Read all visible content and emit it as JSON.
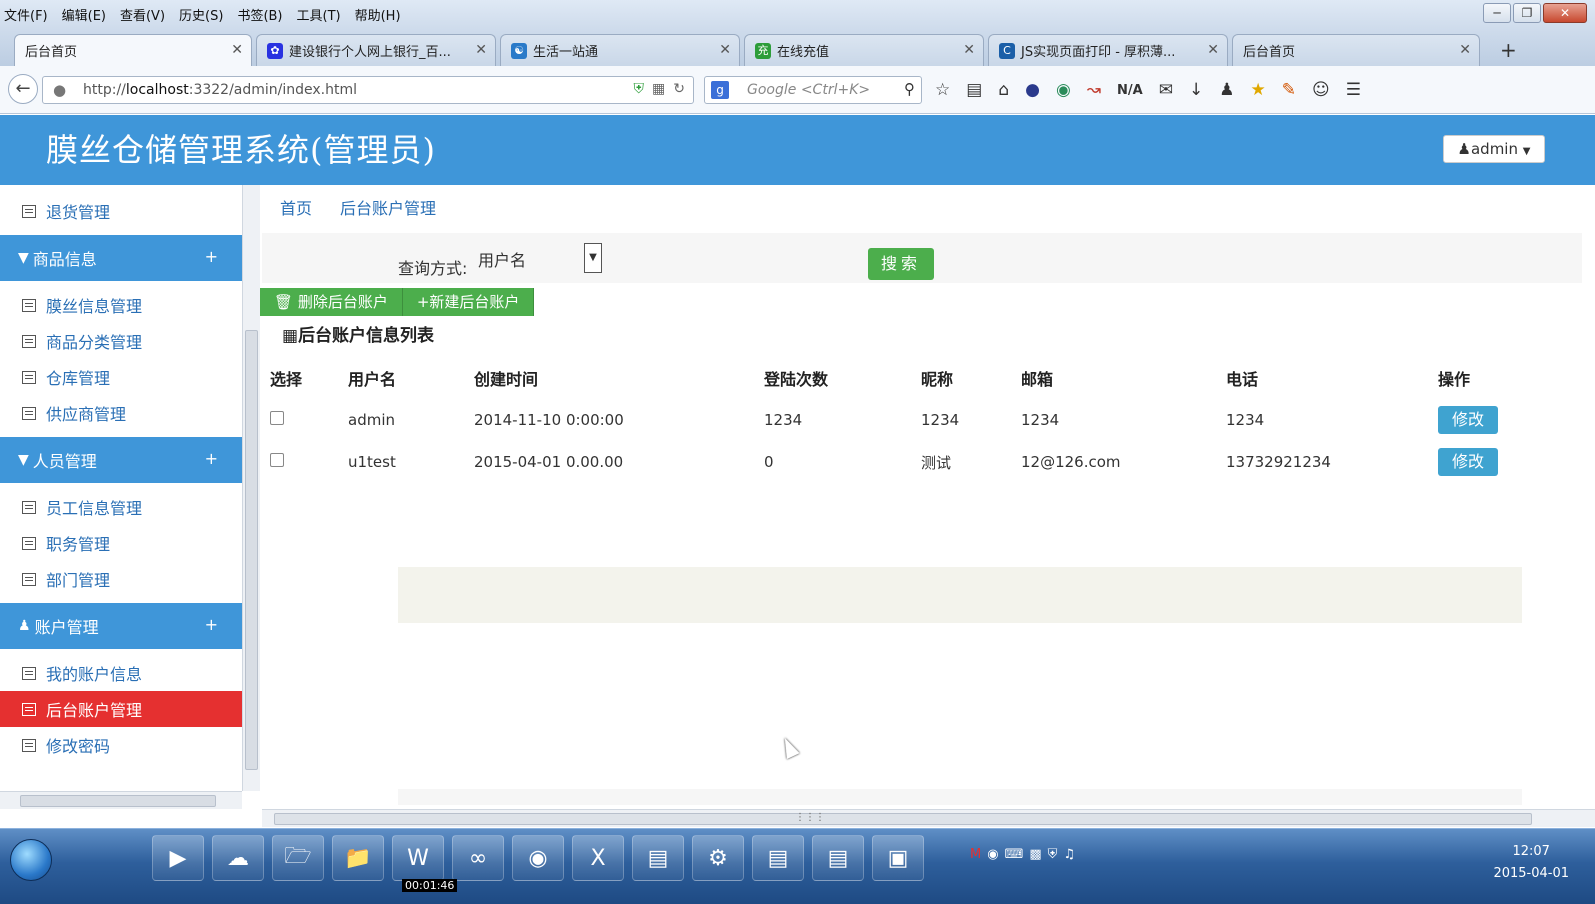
{
  "menubar": {
    "items": [
      "文件(F)",
      "编辑(E)",
      "查看(V)",
      "历史(S)",
      "书签(B)",
      "工具(T)",
      "帮助(H)"
    ]
  },
  "tabs": [
    {
      "label": "后台首页",
      "active": true,
      "icon": "page-icon",
      "icon_color": ""
    },
    {
      "label": "建设银行个人网上银行_百...",
      "active": false,
      "icon": "baidu-paw-icon",
      "icon_color": "#2932e1"
    },
    {
      "label": "生活一站通",
      "active": false,
      "icon": "service-icon",
      "icon_color": "#2a7ac9"
    },
    {
      "label": "在线充值",
      "active": false,
      "icon": "recharge-icon",
      "icon_color": "#2d9d3a"
    },
    {
      "label": "JS实现页面打印 - 厚积薄...",
      "active": false,
      "icon": "blog-icon",
      "icon_color": "#1b5fa8"
    },
    {
      "label": "后台首页",
      "active": false,
      "icon": "page-icon",
      "icon_color": ""
    }
  ],
  "navbar": {
    "url_prefix": "http://",
    "url_host": "localhost",
    "url_rest": ":3322/admin/index.html",
    "search_placeholder": "Google <Ctrl+K>",
    "na_label": "N/A"
  },
  "app": {
    "title": "膜丝仓储管理系统(管理员)",
    "user_button": "admin",
    "header_color": "#3f96d9"
  },
  "sidebar": {
    "top_item": "退货管理",
    "groups": [
      {
        "label": "商品信息",
        "icon": "filter-icon",
        "items": [
          "膜丝信息管理",
          "商品分类管理",
          "仓库管理",
          "供应商管理"
        ]
      },
      {
        "label": "人员管理",
        "icon": "filter-icon",
        "items": [
          "员工信息管理",
          "职务管理",
          "部门管理"
        ]
      },
      {
        "label": "账户管理",
        "icon": "user-icon",
        "items": [
          "我的账户信息",
          "后台账户管理",
          "修改密码"
        ]
      }
    ],
    "active_item": "后台账户管理",
    "active_color": "#e53030"
  },
  "breadcrumb": [
    "首页",
    "后台账户管理"
  ],
  "query": {
    "label": "查询方式:",
    "selected": "用户名",
    "search_button": "搜索"
  },
  "actions": {
    "delete_label": "删除后台账户",
    "new_label": "新建后台账户"
  },
  "list": {
    "title": "后台账户信息列表",
    "columns": [
      "选择",
      "用户名",
      "创建时间",
      "登陆次数",
      "昵称",
      "邮箱",
      "电话",
      "操作"
    ],
    "rows": [
      {
        "username": "admin",
        "created": "2014-11-10 0:00:00",
        "logins": "1234",
        "nickname": "1234",
        "email": "1234",
        "phone": "1234",
        "action": "修改"
      },
      {
        "username": "u1test",
        "created": "2015-04-01 0.00.00",
        "logins": "0",
        "nickname": "测试",
        "email": "12@126.com",
        "phone": "13732921234",
        "action": "修改"
      }
    ]
  },
  "taskbar": {
    "timer": "00:01:46",
    "time": "12:07",
    "date": "2015-04-01"
  }
}
